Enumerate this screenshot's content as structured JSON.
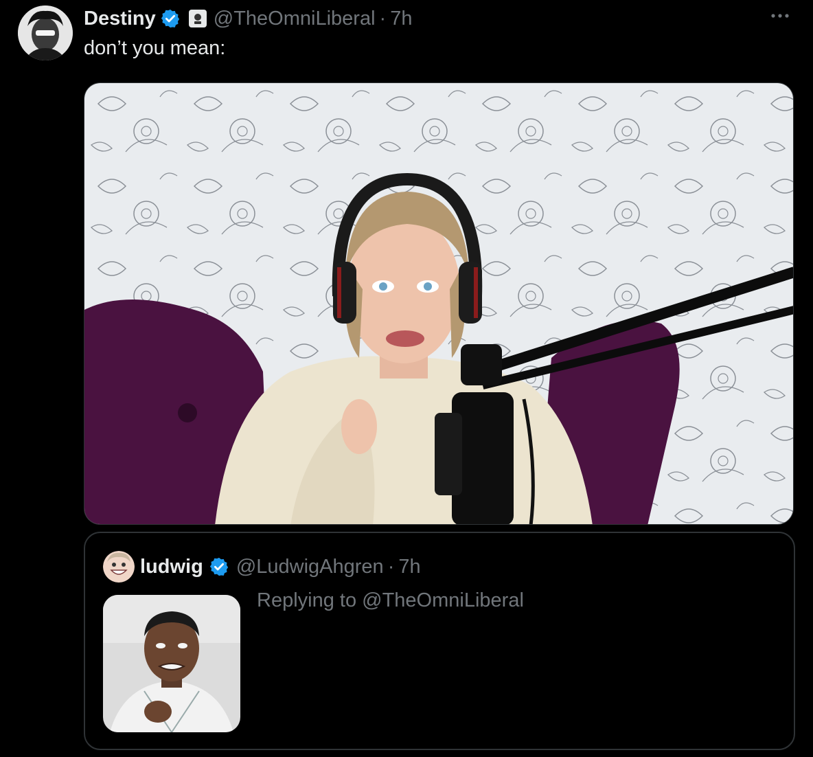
{
  "tweet": {
    "display_name": "Destiny",
    "handle": "@TheOmniLiberal",
    "separator": "·",
    "time": "7h",
    "text": "don’t you mean:",
    "more_icon": "more-horizontal-icon",
    "verified_icon": "verified-badge-icon"
  },
  "quote": {
    "display_name": "ludwig",
    "handle": "@LudwigAhgren",
    "separator": "·",
    "time": "7h",
    "reply_text": "Replying to @TheOmniLiberal"
  },
  "colors": {
    "background": "#000000",
    "text": "#e7e9ea",
    "muted": "#71767b",
    "border": "#2f3336",
    "verified": "#1d9bf0"
  }
}
